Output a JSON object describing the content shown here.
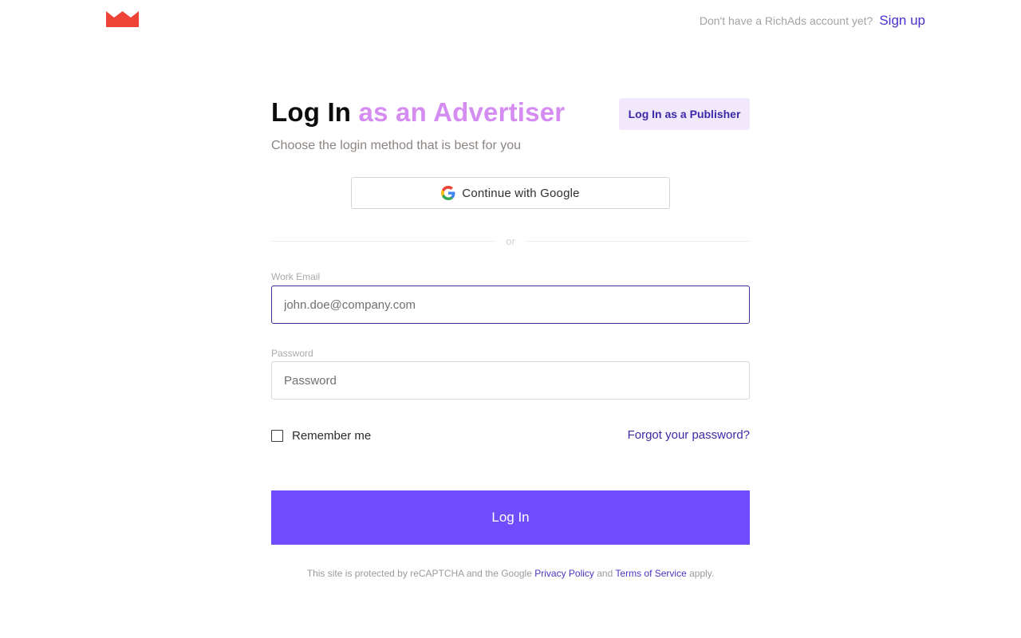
{
  "header": {
    "logo_icon": "crown-icon",
    "brand_color": "#f04337",
    "prompt": "Don't have a RichAds account yet?",
    "signup_label": "Sign up"
  },
  "login": {
    "title_part1": "Log In",
    "title_part2": "as an Advertiser",
    "publisher_button": "Log In as a Publisher",
    "subtitle": "Choose the login method that is best for you",
    "google_button": "Continue with Google",
    "google_icon": "google-g-icon",
    "divider_text": "or",
    "email_label": "Work Email",
    "email_value": "",
    "email_placeholder": "john.doe@company.com",
    "password_label": "Password",
    "password_value": "",
    "password_placeholder": "Password",
    "remember_label": "Remember me",
    "remember_checked": false,
    "forgot_label": "Forgot your password?",
    "submit_label": "Log In",
    "accent_color": "#6f4dfe"
  },
  "legal": {
    "prefix": "This site is protected by reCAPTCHA and the Google ",
    "privacy_label": "Privacy Policy",
    "and": " and ",
    "terms_label": "Terms of Service",
    "suffix": " apply."
  }
}
